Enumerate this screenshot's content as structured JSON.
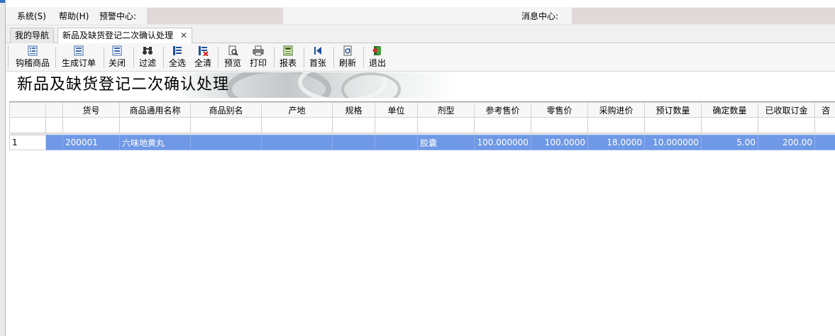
{
  "menubar": {
    "system": "系统(S)",
    "help": "帮助(H)",
    "alert_center": "预警中心:",
    "message_center": "消息中心:"
  },
  "tabs": [
    {
      "label": "我的导航"
    },
    {
      "label": "新品及缺货登记二次确认处理",
      "close": "✕"
    }
  ],
  "toolbar": {
    "buttons": [
      {
        "label": "钩稽商品",
        "icon": "list-icon"
      },
      {
        "label": "生成订单",
        "icon": "list-icon"
      },
      {
        "label": "关闭",
        "icon": "list-icon"
      },
      {
        "label": "过滤",
        "icon": "binoculars-icon"
      },
      {
        "label": "全选",
        "icon": "select-all-icon"
      },
      {
        "label": "全清",
        "icon": "clear-all-icon"
      },
      {
        "label": "预览",
        "icon": "preview-icon"
      },
      {
        "label": "打印",
        "icon": "printer-icon"
      },
      {
        "label": "报表",
        "icon": "report-icon"
      },
      {
        "label": "首张",
        "icon": "first-record-icon"
      },
      {
        "label": "刷新",
        "icon": "refresh-icon"
      },
      {
        "label": "退出",
        "icon": "exit-door-icon"
      }
    ]
  },
  "banner": {
    "title": "新品及缺货登记二次确认处理"
  },
  "grid": {
    "columns": [
      "货号",
      "商品通用名称",
      "商品别名",
      "产地",
      "规格",
      "单位",
      "剂型",
      "参考售价",
      "零售价",
      "采购进价",
      "预订数量",
      "确定数量",
      "已收取订金",
      "咨"
    ],
    "rows": [
      {
        "rownum": "1",
        "cells": [
          "200001",
          "六味地黄丸",
          "",
          "",
          "",
          "",
          "胶囊",
          "100.000000",
          "100.0000",
          "18.0000",
          "10.000000",
          "5.00",
          "200.00",
          ""
        ]
      }
    ]
  },
  "colors": {
    "selected_row": "#6f98e6",
    "field_bg": "#e1d9d9"
  }
}
